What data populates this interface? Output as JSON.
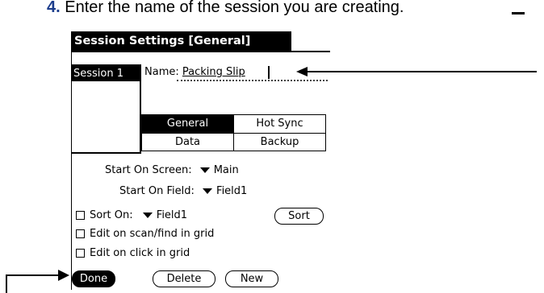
{
  "instruction": {
    "number": "4.",
    "text": " Enter the name of the session you are creating."
  },
  "dialog": {
    "title": "Session Settings [General]",
    "session_list": {
      "selected": "Session 1"
    },
    "name_label": "Name:",
    "name_value": "Packing Slip",
    "tabs": [
      "General",
      "Hot Sync",
      "Data",
      "Backup"
    ],
    "start_on_screen": {
      "label": "Start On Screen:",
      "value": "Main"
    },
    "start_on_field": {
      "label": "Start On Field:",
      "value": "Field1"
    },
    "sort_on": {
      "label": "Sort On:",
      "value": "Field1",
      "button": "Sort"
    },
    "options": [
      "Edit on scan/find in grid",
      "Edit on click in grid"
    ],
    "buttons": {
      "done": "Done",
      "delete": "Delete",
      "new": "New"
    }
  }
}
